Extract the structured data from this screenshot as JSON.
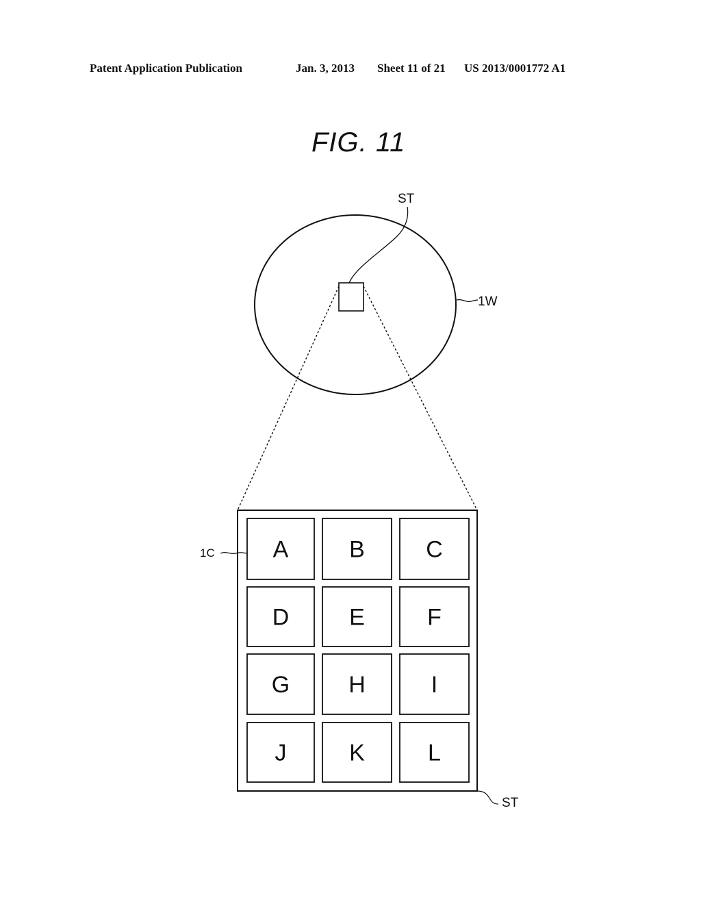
{
  "header": {
    "publication": "Patent Application Publication",
    "date": "Jan. 3, 2013",
    "sheet": "Sheet 11 of 21",
    "number": "US 2013/0001772 A1"
  },
  "figure": {
    "title": "FIG.  11",
    "labels": {
      "wafer": "1W",
      "shot_top": "ST",
      "shot_bottom": "ST",
      "chip": "1C"
    },
    "grid": {
      "rows": 4,
      "cols": 3,
      "cells": [
        "A",
        "B",
        "C",
        "D",
        "E",
        "F",
        "G",
        "H",
        "I",
        "J",
        "K",
        "L"
      ]
    }
  }
}
